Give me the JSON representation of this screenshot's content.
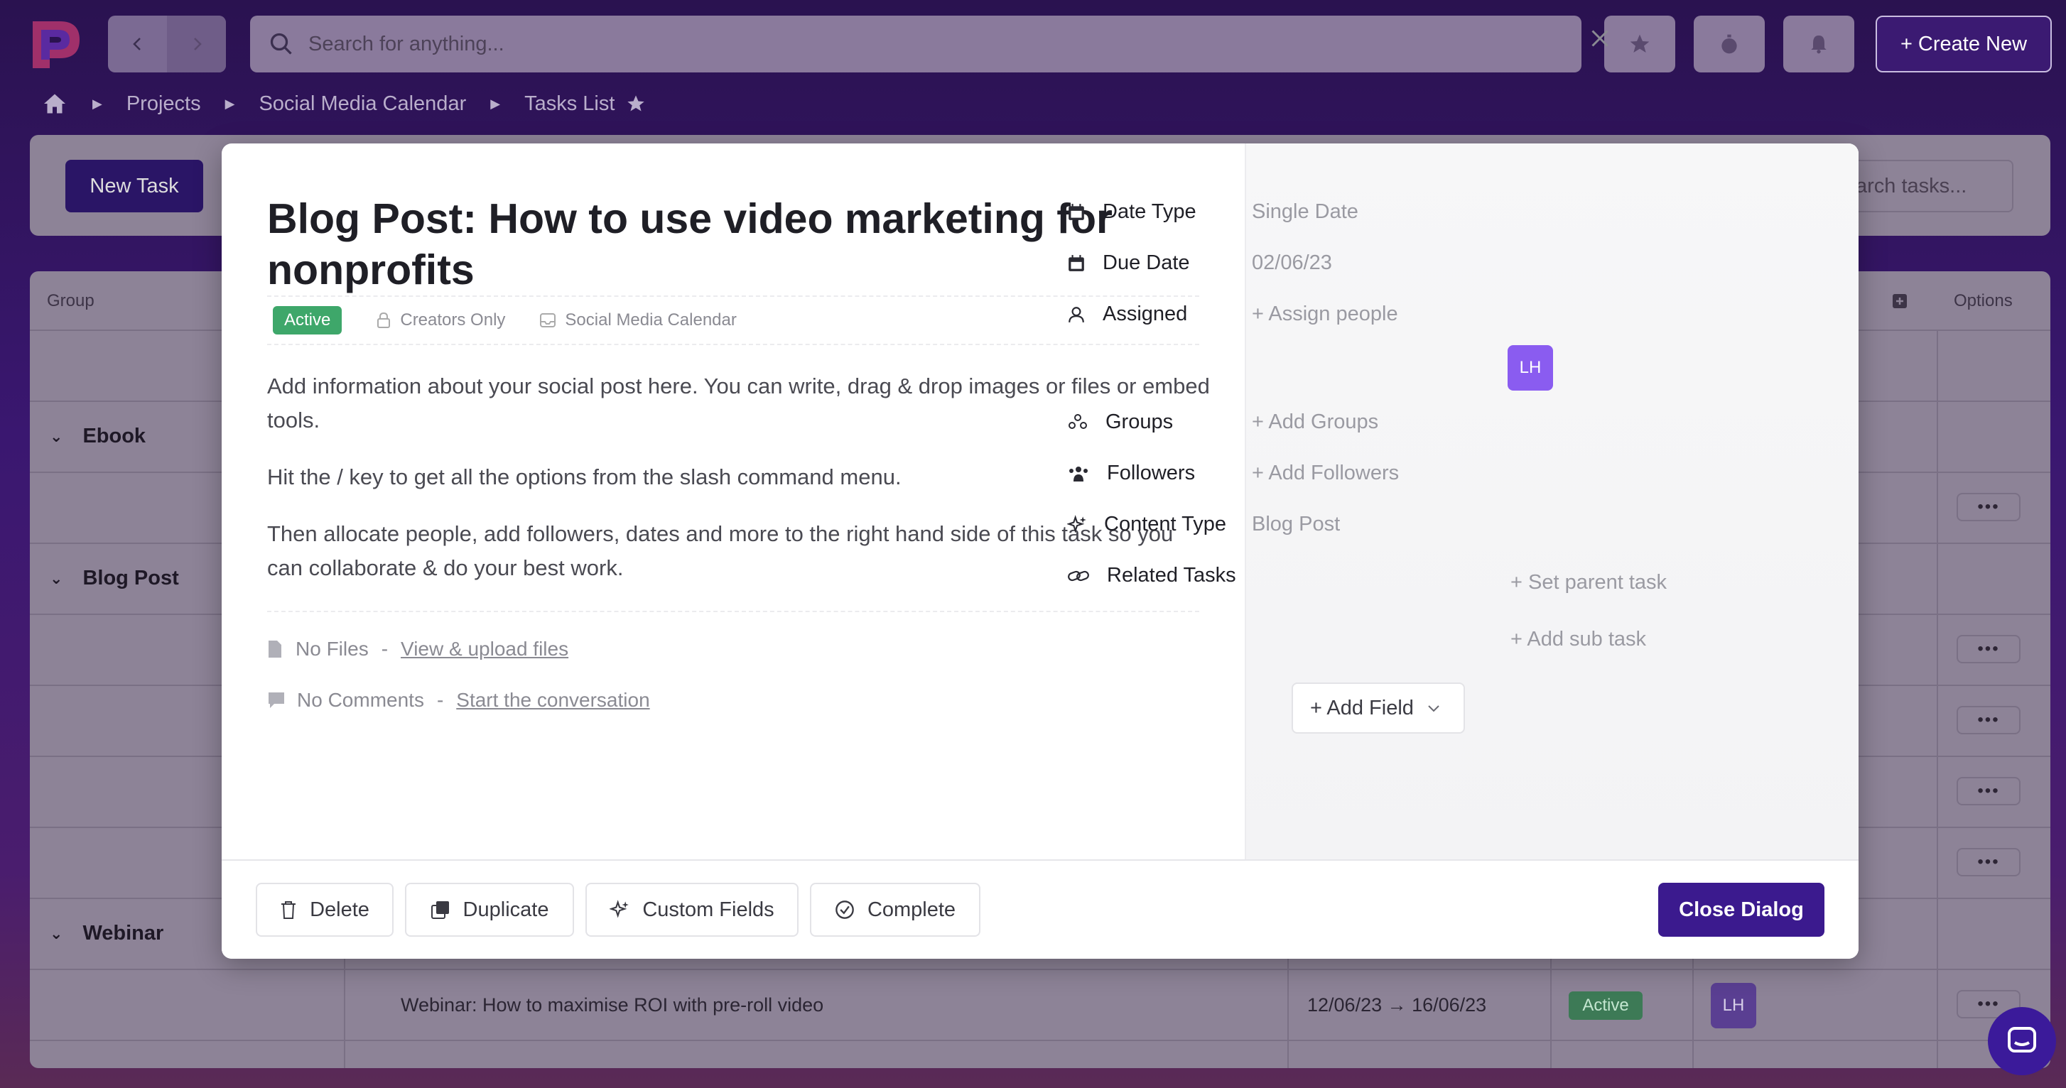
{
  "search": {
    "placeholder": "Search for anything..."
  },
  "header": {
    "create_label": "+ Create New"
  },
  "breadcrumb": {
    "items": [
      "Projects",
      "Social Media Calendar",
      "Tasks List"
    ]
  },
  "toolbar": {
    "new_task_label": "New Task",
    "search_tasks_placeholder": "arch tasks..."
  },
  "table": {
    "headers": {
      "group": "Group",
      "options": "Options"
    },
    "groups": [
      {
        "label": "Ebook"
      },
      {
        "label": "Blog Post"
      },
      {
        "label": "Webinar"
      }
    ],
    "webinar_row": {
      "title": "Webinar: How to maximise ROI with pre-roll video",
      "dates": "12/06/23 → 16/06/23",
      "status": "Active",
      "assignee": "LH"
    },
    "row_menu": "•••"
  },
  "modal": {
    "title": "Blog Post: How to use video marketing for nonprofits",
    "status": "Active",
    "visibility": "Creators Only",
    "project": "Social Media Calendar",
    "description": [
      "Add information about your social post here. You can write, drag & drop images or files or embed tools.",
      "Hit the / key to get all the options from the slash command menu.",
      "Then allocate people, add followers, dates and more to the right hand side of this task so you can collaborate & do your best work."
    ],
    "files": {
      "label": "No Files",
      "sep": "-",
      "link": "View & upload files"
    },
    "comments": {
      "label": "No Comments",
      "sep": "-",
      "link": "Start the conversation"
    },
    "properties": {
      "date_type": {
        "label": "Date Type",
        "value": "Single Date"
      },
      "due_date": {
        "label": "Due Date",
        "value": "02/06/23"
      },
      "assigned": {
        "label": "Assigned",
        "value": "+ Assign people",
        "avatar": "LH"
      },
      "groups": {
        "label": "Groups",
        "value": "+ Add Groups"
      },
      "followers": {
        "label": "Followers",
        "value": "+ Add Followers"
      },
      "content_type": {
        "label": "Content Type",
        "value": "Blog Post"
      },
      "related_tasks": {
        "label": "Related Tasks",
        "parent": "+ Set parent task",
        "sub": "+ Add sub task"
      }
    },
    "add_field_label": "+ Add Field",
    "footer": {
      "delete": "Delete",
      "duplicate": "Duplicate",
      "custom_fields": "Custom Fields",
      "complete": "Complete",
      "close": "Close Dialog"
    }
  },
  "colors": {
    "accent": "#3b1a8e",
    "active": "#3ea76a",
    "avatar": "#8a5cf0"
  }
}
